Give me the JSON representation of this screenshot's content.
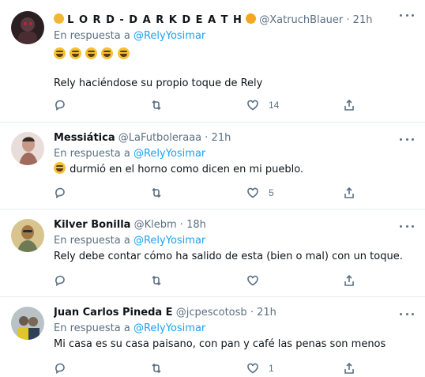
{
  "tweets": [
    {
      "name_prefix_icon": "skull-emoji-icon",
      "name": "L O R D - D A R K D E A T H",
      "name_suffix_icon": "face-screaming-emoji-icon",
      "handle": "@XatruchBlauer",
      "dot": "·",
      "time": "21h",
      "reply_prefix": "En respuesta a",
      "reply_mention": "@RelyYosimar",
      "emoji_line": [
        "rofl-emoji-icon",
        "rofl-emoji-icon",
        "rofl-emoji-icon",
        "rofl-emoji-icon",
        "rofl-emoji-icon"
      ],
      "text": "Rely haciéndose su propio toque de Rely",
      "likes": "14",
      "avatar_color": "#3a2a2a"
    },
    {
      "name": "Messiática",
      "handle": "@LaFutboleraaa",
      "dot": "·",
      "time": "21h",
      "reply_prefix": "En respuesta a",
      "reply_mention": "@RelyYosimar",
      "text": "durmió en el horno como dicen en mi pueblo.",
      "text_emoji": "rofl-emoji-icon",
      "likes": "5",
      "avatar_color": "#b7867a"
    },
    {
      "name": "Kilver Bonilla",
      "handle": "@Klebm",
      "dot": "·",
      "time": "18h",
      "reply_prefix": "En respuesta a",
      "reply_mention": "@RelyYosimar",
      "text": "Rely debe contar cómo ha salido de esta (bien o mal) con un toque.",
      "likes": "",
      "avatar_color": "#c9a85e"
    },
    {
      "name": "Juan Carlos Pineda E",
      "handle": "@jcpescotosb",
      "dot": "·",
      "time": "21h",
      "reply_prefix": "En respuesta a",
      "reply_mention": "@RelyYosimar",
      "text": "Mi casa es su casa paisano, con pan y café las penas son menos",
      "likes": "1",
      "avatar_color": "#8c9aa0"
    }
  ],
  "colors": {
    "link": "#1da1f2",
    "muted": "#5b7083",
    "divider": "#e6ecf0"
  }
}
